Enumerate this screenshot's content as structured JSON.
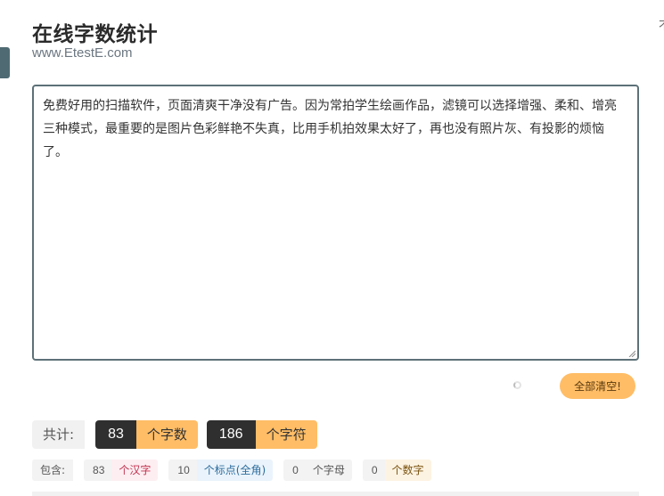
{
  "header": {
    "title": "在线字数统计",
    "subtitle": "www.EtestE.com",
    "corner_glyph": "不"
  },
  "editor": {
    "text": "免费好用的扫描软件，页面清爽干净没有广告。因为常拍学生绘画作品，滤镜可以选择增强、柔和、增亮三种模式，最重要的是图片色彩鲜艳不失真，比用手机拍效果太好了，再也没有照片灰、有投影的烦恼了。"
  },
  "actions": {
    "clear_label": "全部清空!"
  },
  "totals": {
    "label": "共计:",
    "word_count": "83",
    "word_unit": "个字数",
    "char_count": "186",
    "char_unit": "个字符"
  },
  "breakdown": {
    "label": "包含:",
    "items": [
      {
        "count": "83",
        "label": "个汉字"
      },
      {
        "count": "10",
        "label": "个标点(全角)"
      },
      {
        "count": "0",
        "label": "个字母"
      },
      {
        "count": "0",
        "label": "个数字"
      }
    ]
  },
  "colors": {
    "accent": "#ffbd66",
    "dark": "#2f2f2f",
    "border": "#5d7178"
  }
}
